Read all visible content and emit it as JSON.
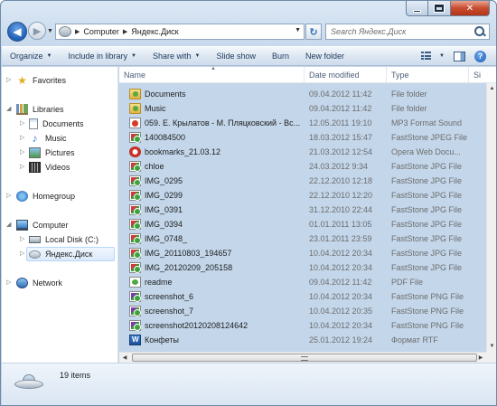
{
  "window": {
    "title": "Яндекс.Диск"
  },
  "caption": {
    "min": "",
    "max": "",
    "close": "✕"
  },
  "nav": {
    "back_glyph": "◀",
    "forward_glyph": "▶",
    "address": [
      "Computer",
      "Яндекс.Диск"
    ],
    "search_placeholder": "Search Яндекс.Диск"
  },
  "toolbar": {
    "items": [
      "Organize",
      "Include in library",
      "Share with",
      "Slide show",
      "Burn",
      "New folder"
    ]
  },
  "sidebar": {
    "items": [
      {
        "label": "Favorites",
        "icon": "star-icon"
      },
      {
        "label": "Libraries",
        "icon": "libraries-icon"
      },
      {
        "label": "Documents",
        "icon": "documents-icon"
      },
      {
        "label": "Music",
        "icon": "music-icon"
      },
      {
        "label": "Pictures",
        "icon": "pictures-icon"
      },
      {
        "label": "Videos",
        "icon": "videos-icon"
      },
      {
        "label": "Homegroup",
        "icon": "homegroup-icon"
      },
      {
        "label": "Computer",
        "icon": "computer-icon"
      },
      {
        "label": "Local Disk (C:)",
        "icon": "local-disk-icon"
      },
      {
        "label": "Яндекс.Диск",
        "icon": "yandex-disk-icon",
        "selected": true
      },
      {
        "label": "Network",
        "icon": "network-icon"
      }
    ]
  },
  "columns": [
    "Name",
    "Date modified",
    "Type",
    "Si"
  ],
  "files": [
    {
      "name": "Documents",
      "date": "09.04.2012 11:42",
      "type": "File folder",
      "icon": "folder"
    },
    {
      "name": "Music",
      "date": "09.04.2012 11:42",
      "type": "File folder",
      "icon": "folder"
    },
    {
      "name": "059. Е. Крылатов - М. Пляцковский - Вс...",
      "date": "12.05.2011 19:10",
      "type": "MP3 Format Sound",
      "icon": "mp3"
    },
    {
      "name": "140084500",
      "date": "18.03.2012 15:47",
      "type": "FastStone JPEG File",
      "icon": "img"
    },
    {
      "name": "bookmarks_21.03.12",
      "date": "21.03.2012 12:54",
      "type": "Opera Web Docu...",
      "icon": "opera"
    },
    {
      "name": "chloe",
      "date": "24.03.2012 9:34",
      "type": "FastStone JPG File",
      "icon": "img"
    },
    {
      "name": "IMG_0295",
      "date": "22.12.2010 12:18",
      "type": "FastStone JPG File",
      "icon": "img"
    },
    {
      "name": "IMG_0299",
      "date": "22.12.2010 12:20",
      "type": "FastStone JPG File",
      "icon": "img"
    },
    {
      "name": "IMG_0391",
      "date": "31.12.2010 22:44",
      "type": "FastStone JPG File",
      "icon": "img"
    },
    {
      "name": "IMG_0394",
      "date": "01.01.2011 13:05",
      "type": "FastStone JPG File",
      "icon": "img"
    },
    {
      "name": "IMG_0748_",
      "date": "23.01.2011 23:59",
      "type": "FastStone JPG File",
      "icon": "img"
    },
    {
      "name": "IMG_20110803_194657",
      "date": "10.04.2012 20:34",
      "type": "FastStone JPG File",
      "icon": "img"
    },
    {
      "name": "IMG_20120209_205158",
      "date": "10.04.2012 20:34",
      "type": "FastStone JPG File",
      "icon": "img"
    },
    {
      "name": "readme",
      "date": "09.04.2012 11:42",
      "type": "PDF File",
      "icon": "pdf"
    },
    {
      "name": "screenshot_6",
      "date": "10.04.2012 20:34",
      "type": "FastStone PNG File",
      "icon": "png"
    },
    {
      "name": "screenshot_7",
      "date": "10.04.2012 20:35",
      "type": "FastStone PNG File",
      "icon": "png"
    },
    {
      "name": "screenshot20120208124642",
      "date": "10.04.2012 20:34",
      "type": "FastStone PNG File",
      "icon": "png"
    },
    {
      "name": "Конфеты",
      "date": "25.01.2012 19:24",
      "type": "Формат RTF",
      "icon": "rtf"
    }
  ],
  "status": {
    "count": "19 items"
  }
}
